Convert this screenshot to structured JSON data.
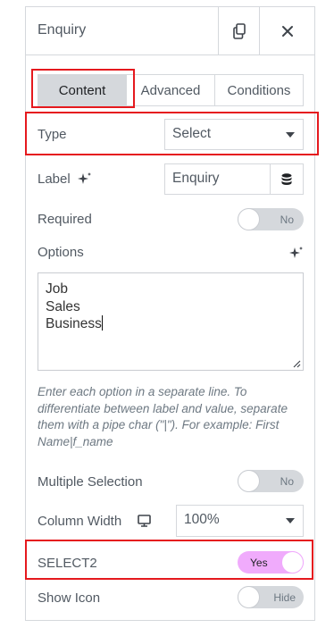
{
  "header": {
    "title": "Enquiry"
  },
  "tabs": [
    {
      "label": "Content",
      "active": true
    },
    {
      "label": "Advanced",
      "active": false
    },
    {
      "label": "Conditions",
      "active": false
    }
  ],
  "type_field": {
    "label": "Type",
    "value": "Select"
  },
  "label_field": {
    "label": "Label",
    "value": "Enquiry"
  },
  "required": {
    "label": "Required",
    "state": "No"
  },
  "options": {
    "label": "Options",
    "lines": [
      "Job",
      "Sales",
      "Business"
    ]
  },
  "help_text": "Enter each option in a separate line. To differentiate between label and value, separate them with a pipe char (\"|\"). For example: First Name|f_name",
  "multiple_selection": {
    "label": "Multiple Selection",
    "state": "No"
  },
  "column_width": {
    "label": "Column Width",
    "value": "100%"
  },
  "select2": {
    "label": "SELECT2",
    "state": "Yes"
  },
  "show_icon": {
    "label": "Show Icon",
    "state": "Hide"
  },
  "colors": {
    "highlight": "#e5191e",
    "toggle_on": "#f0abfc",
    "toggle_off": "#d5d8dc",
    "border": "#d5d8dc"
  }
}
